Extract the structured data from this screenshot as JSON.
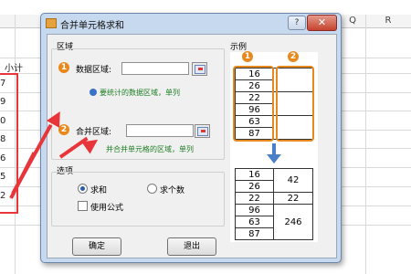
{
  "spreadsheet": {
    "columns": [
      "Q",
      "R"
    ],
    "header_cell": "小计",
    "row_tail_digits": [
      "7",
      "9",
      "0",
      "8",
      "6",
      "5",
      "2"
    ]
  },
  "dialog": {
    "title": "合并单元格求和",
    "help_label": "?",
    "close_label": "✕",
    "region_group": {
      "label": "区域",
      "data_field": {
        "number": "1",
        "label": "数据区域:",
        "value": "",
        "hint": "要统计的数据区域，单列"
      },
      "merge_field": {
        "number": "2",
        "label": "合并区域:",
        "value": "",
        "hint": "并合并单元格的区域，单列"
      }
    },
    "options_group": {
      "label": "选项",
      "sum_label": "求和",
      "count_label": "求个数",
      "selected": "sum",
      "formula_label": "使用公式",
      "formula_checked": false
    },
    "ok_label": "确定",
    "exit_label": "退出",
    "example": {
      "label": "示例",
      "badge_1": "1",
      "badge_2": "2",
      "top_values": [
        "16",
        "26",
        "22",
        "96",
        "63",
        "87"
      ],
      "bottom_left": [
        "16",
        "26",
        "22",
        "96",
        "63",
        "87"
      ],
      "bottom_merged": [
        "42",
        "22",
        "246"
      ]
    }
  },
  "colors": {
    "accent_orange": "#e7891d",
    "annotation_red": "#e8353a",
    "hint_green": "#1e7e24",
    "arrow_blue": "#4a7fc9"
  }
}
